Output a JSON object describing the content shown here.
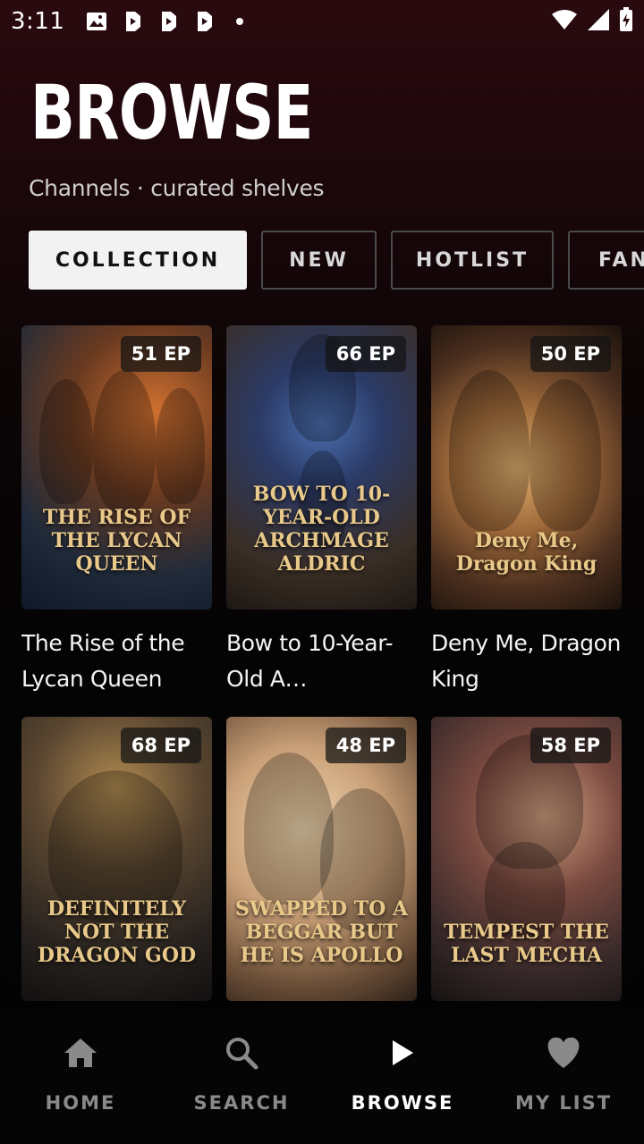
{
  "status_bar": {
    "time": "3:11",
    "notification_icons": [
      "image-icon",
      "play-badge-icon",
      "play-badge-icon",
      "play-badge-icon",
      "dot-icon"
    ],
    "right_icons": [
      "wifi-icon",
      "signal-icon",
      "battery-charging-icon"
    ]
  },
  "header": {
    "title": "BROWSE",
    "subtitle": "Channels · curated shelves"
  },
  "chips": [
    {
      "label": "COLLECTION",
      "active": true
    },
    {
      "label": "NEW",
      "active": false
    },
    {
      "label": "HOTLIST",
      "active": false
    },
    {
      "label": "FAN",
      "active": false
    }
  ],
  "shows": [
    {
      "title": "The Rise of the Lycan Queen",
      "poster_title": "THE RISE OF THE LYCAN QUEEN",
      "episodes": "51 EP"
    },
    {
      "title": "Bow to 10-Year-Old A…",
      "poster_title": "BOW TO 10-YEAR-OLD ARCHMAGE ALDRIC",
      "episodes": "66 EP"
    },
    {
      "title": "Deny Me, Dragon King",
      "poster_title": "Deny Me, Dragon King",
      "episodes": "50 EP"
    },
    {
      "title": "",
      "poster_title": "DEFINITELY NOT THE DRAGON GOD",
      "episodes": "68 EP"
    },
    {
      "title": "",
      "poster_title": "SWAPPED TO A BEGGAR BUT HE IS APOLLO",
      "episodes": "48 EP"
    },
    {
      "title": "",
      "poster_title": "TEMPEST THE LAST MECHA",
      "episodes": "58 EP"
    }
  ],
  "bottom_nav": [
    {
      "label": "HOME",
      "icon": "home-icon",
      "active": false
    },
    {
      "label": "SEARCH",
      "icon": "search-icon",
      "active": false
    },
    {
      "label": "BROWSE",
      "icon": "play-icon",
      "active": true
    },
    {
      "label": "MY LIST",
      "icon": "heart-icon",
      "active": false
    }
  ]
}
